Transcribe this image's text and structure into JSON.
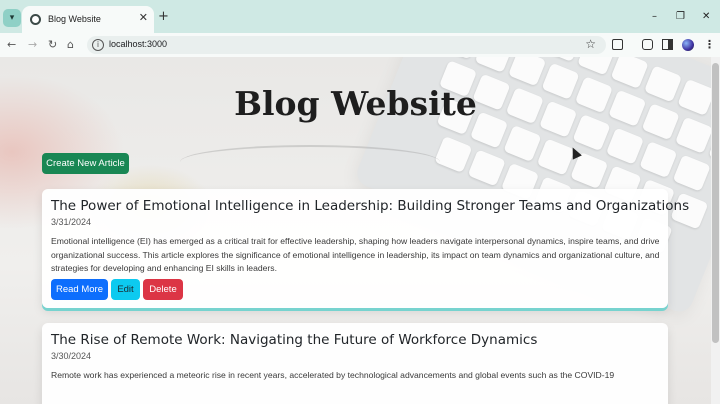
{
  "browser": {
    "tab": {
      "title": "Blog Website",
      "close": "✕"
    },
    "new_tab": "+",
    "window_controls": {
      "minimize": "–",
      "restore": "❐",
      "close": "✕"
    },
    "nav": {
      "back": "←",
      "forward": "→",
      "reload": "↻",
      "home": "⌂"
    },
    "address_bar": {
      "url": "localhost:3000",
      "info": "i",
      "bookmark": "☆"
    },
    "toolbar_icons": [
      "extensions-icon",
      "reading-list-icon",
      "side-panel-icon",
      "profile-avatar",
      "menu-icon"
    ]
  },
  "page": {
    "site_title": "Blog Website",
    "create_button": "Create New Article",
    "articles": [
      {
        "title": "The Power of Emotional Intelligence in Leadership: Building Stronger Teams and Organizations",
        "date": "3/31/2024",
        "excerpt": "Emotional intelligence (EI) has emerged as a critical trait for effective leadership, shaping how leaders navigate interpersonal dynamics, inspire teams, and drive organizational success. This article explores the significance of emotional intelligence in leadership, its impact on team dynamics and organizational culture, and strategies for developing and enhancing EI skills in leaders.",
        "read_more": "Read More",
        "edit": "Edit",
        "delete": "Delete"
      },
      {
        "title": "The Rise of Remote Work: Navigating the Future of Workforce Dynamics",
        "date": "3/30/2024",
        "excerpt": "Remote work has experienced a meteoric rise in recent years, accelerated by technological advancements and global events such as the COVID-19"
      }
    ]
  },
  "colors": {
    "create": "#198754",
    "read_more": "#0d6efd",
    "edit": "#0dcaf0",
    "delete": "#dc3545",
    "card_accent": "#77d3cf",
    "tab_strip": "#cfe9e4"
  }
}
